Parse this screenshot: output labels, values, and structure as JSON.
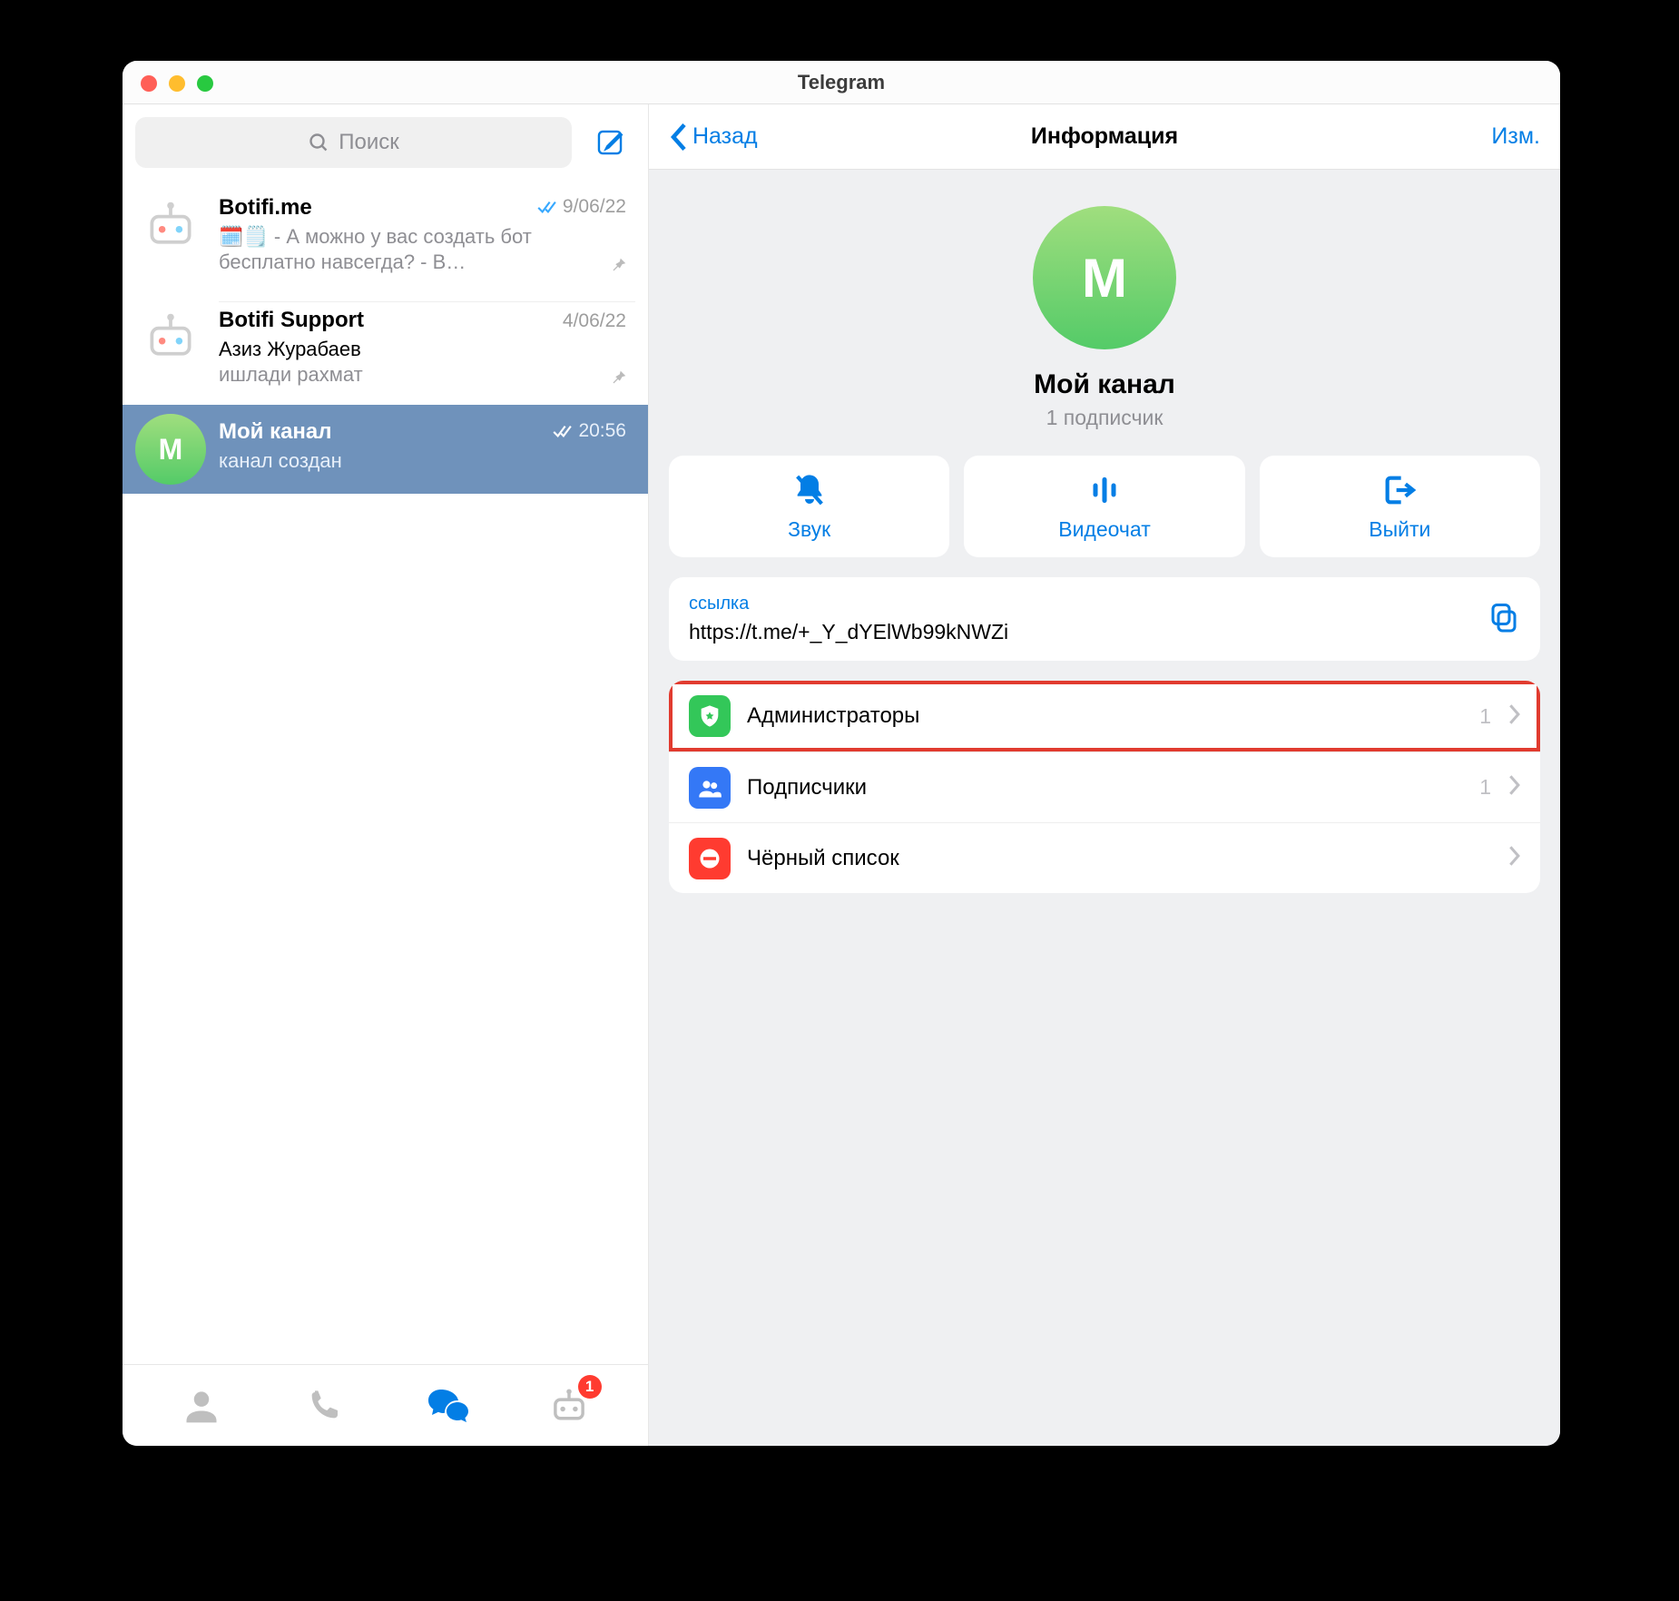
{
  "window": {
    "title": "Telegram"
  },
  "sidebar": {
    "search_placeholder": "Поиск",
    "chats": [
      {
        "name": "Botifi.me",
        "date": "9/06/22",
        "sub": "🗓️🗒️ - А можно у вас создать бот бесплатно навсегда? - В…",
        "readmarks": true,
        "pinned": true,
        "avatar": "robot"
      },
      {
        "name": "Botifi Support",
        "date": "4/06/22",
        "sender": "Азиз Журабаев",
        "sub": "ишлади рахмат",
        "readmarks": false,
        "pinned": true,
        "avatar": "robot"
      },
      {
        "name": "Мой канал",
        "date": "20:56",
        "sub": "канал создан",
        "readmarks": true,
        "avatar": "letter",
        "letter": "М",
        "selected": true
      }
    ],
    "nav_badge": "1"
  },
  "info": {
    "back": "Назад",
    "title": "Информация",
    "edit": "Изм.",
    "avatar_letter": "М",
    "name": "Мой канал",
    "sub": "1 подписчик",
    "actions": {
      "sound": "Звук",
      "video": "Видеочат",
      "leave": "Выйти"
    },
    "link": {
      "label": "ссылка",
      "value": "https://t.me/+_Y_dYElWb99kNWZi"
    },
    "mgmt": [
      {
        "key": "admins",
        "label": "Администраторы",
        "count": "1",
        "icon_color": "green",
        "highlight": true
      },
      {
        "key": "subs",
        "label": "Подписчики",
        "count": "1",
        "icon_color": "blue"
      },
      {
        "key": "black",
        "label": "Чёрный список",
        "count": "",
        "icon_color": "red"
      }
    ]
  }
}
